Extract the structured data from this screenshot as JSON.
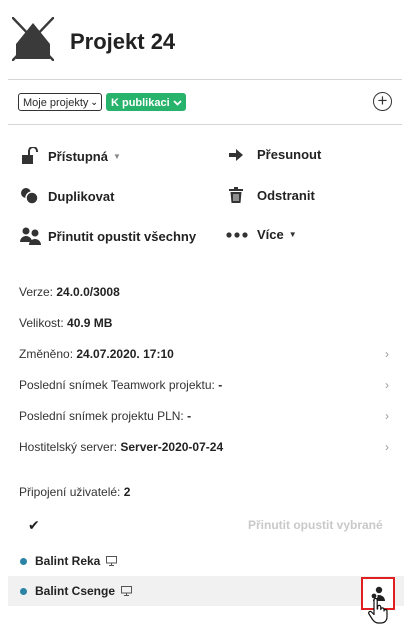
{
  "header": {
    "title": "Projekt 24",
    "logo_icon": "house-icon"
  },
  "filters": {
    "scope_label": "Moje projekty",
    "status_label": "K publikaci",
    "status_color": "#27b36b",
    "add_icon": "plus-circle-icon"
  },
  "actions": {
    "access": "Přístupná",
    "move": "Přesunout",
    "duplicate": "Duplikovat",
    "delete": "Odstranit",
    "force_leave_all": "Přinutit opustit všechny",
    "more": "Více"
  },
  "info": {
    "version_label": "Verze:",
    "version_value": "24.0.0/3008",
    "size_label": "Velikost:",
    "size_value": "40.9 MB",
    "changed_label": "Změněno:",
    "changed_value": "24.07.2020. 17:10",
    "teamwork_snapshot_label": "Poslední snímek Teamwork projektu:",
    "teamwork_snapshot_value": "-",
    "pln_snapshot_label": "Poslední snímek projektu PLN:",
    "pln_snapshot_value": "-",
    "host_label": "Hostitelský server:",
    "host_value": "Server-2020-07-24"
  },
  "users": {
    "connections_label": "Připojení uživatelé:",
    "connections_count": "2",
    "force_leave_selected": "Přinutit opustit vybrané",
    "list": [
      {
        "name": "Balint Reka",
        "status_color": "#2b83a6"
      },
      {
        "name": "Balint Csenge",
        "status_color": "#2b83a6"
      }
    ]
  }
}
